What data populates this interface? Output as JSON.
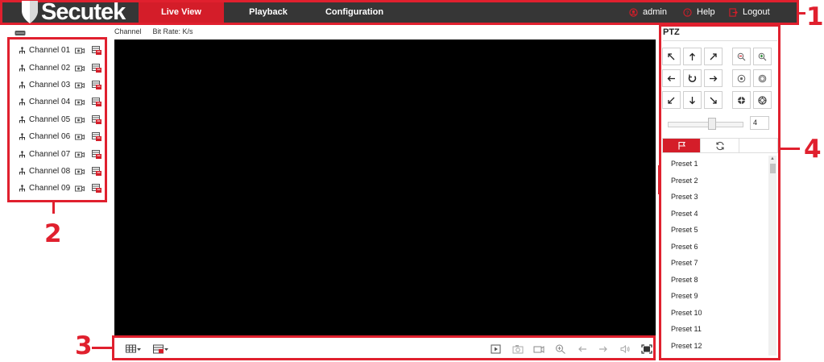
{
  "header": {
    "logo_text": "Secutek",
    "tabs": [
      {
        "label": "Live View",
        "active": true
      },
      {
        "label": "Playback",
        "active": false
      },
      {
        "label": "Configuration",
        "active": false
      }
    ],
    "user": "admin",
    "help_label": "Help",
    "logout_label": "Logout"
  },
  "callouts": {
    "one": "1",
    "two": "2",
    "three": "3",
    "four": "4"
  },
  "channels": [
    "Channel 01",
    "Channel 02",
    "Channel 03",
    "Channel 04",
    "Channel 05",
    "Channel 06",
    "Channel 07",
    "Channel 08",
    "Channel 09"
  ],
  "video": {
    "channel_label": "Channel",
    "bitrate_label": "Bit Rate: K/s"
  },
  "ptz": {
    "title": "PTZ",
    "speed_value": "4",
    "presets": [
      "Preset 1",
      "Preset 2",
      "Preset 3",
      "Preset 4",
      "Preset 5",
      "Preset 6",
      "Preset 7",
      "Preset 8",
      "Preset 9",
      "Preset 10",
      "Preset 11",
      "Preset 12"
    ]
  },
  "colors": {
    "accent": "#d41d29",
    "callout": "#e0202e",
    "topbar": "#363636",
    "video": "#000000"
  }
}
